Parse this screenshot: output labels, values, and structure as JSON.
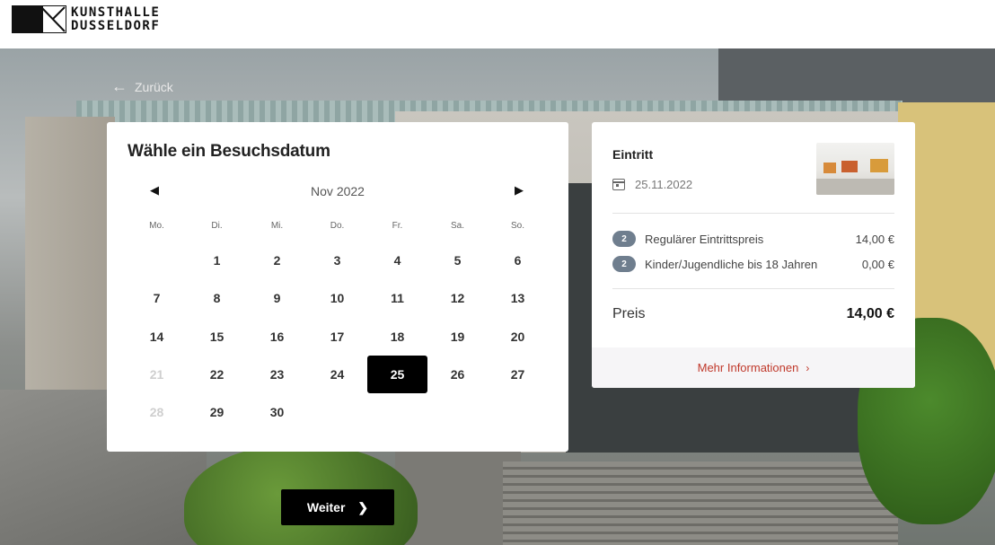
{
  "header": {
    "logo_line1": "KUNSTHALLE",
    "logo_line2": "DUSSELDORF"
  },
  "back": {
    "label": "Zurück"
  },
  "calendar": {
    "title": "Wähle ein Besuchsdatum",
    "month": "Nov 2022",
    "weekdays": [
      "Mo.",
      "Di.",
      "Mi.",
      "Do.",
      "Fr.",
      "Sa.",
      "So."
    ],
    "selected_day": "25",
    "disabled_days": [
      "21",
      "28"
    ],
    "leading_blanks": 1,
    "days": [
      "1",
      "2",
      "3",
      "4",
      "5",
      "6",
      "7",
      "8",
      "9",
      "10",
      "11",
      "12",
      "13",
      "14",
      "15",
      "16",
      "17",
      "18",
      "19",
      "20",
      "21",
      "22",
      "23",
      "24",
      "25",
      "26",
      "27",
      "28",
      "29",
      "30"
    ]
  },
  "ticket": {
    "title": "Eintritt",
    "date": "25.11.2022",
    "rows": [
      {
        "count": "2",
        "label": "Regulärer Eintrittspreis",
        "price": "14,00 €"
      },
      {
        "count": "2",
        "label": "Kinder/Jugendliche bis 18 Jahren",
        "price": "0,00 €"
      }
    ],
    "total_label": "Preis",
    "total_value": "14,00 €",
    "more_label": "Mehr Informationen"
  },
  "actions": {
    "next_label": "Weiter"
  },
  "colors": {
    "accent": "#c0392b",
    "selected": "#000000",
    "badge": "#6f7e8e"
  }
}
